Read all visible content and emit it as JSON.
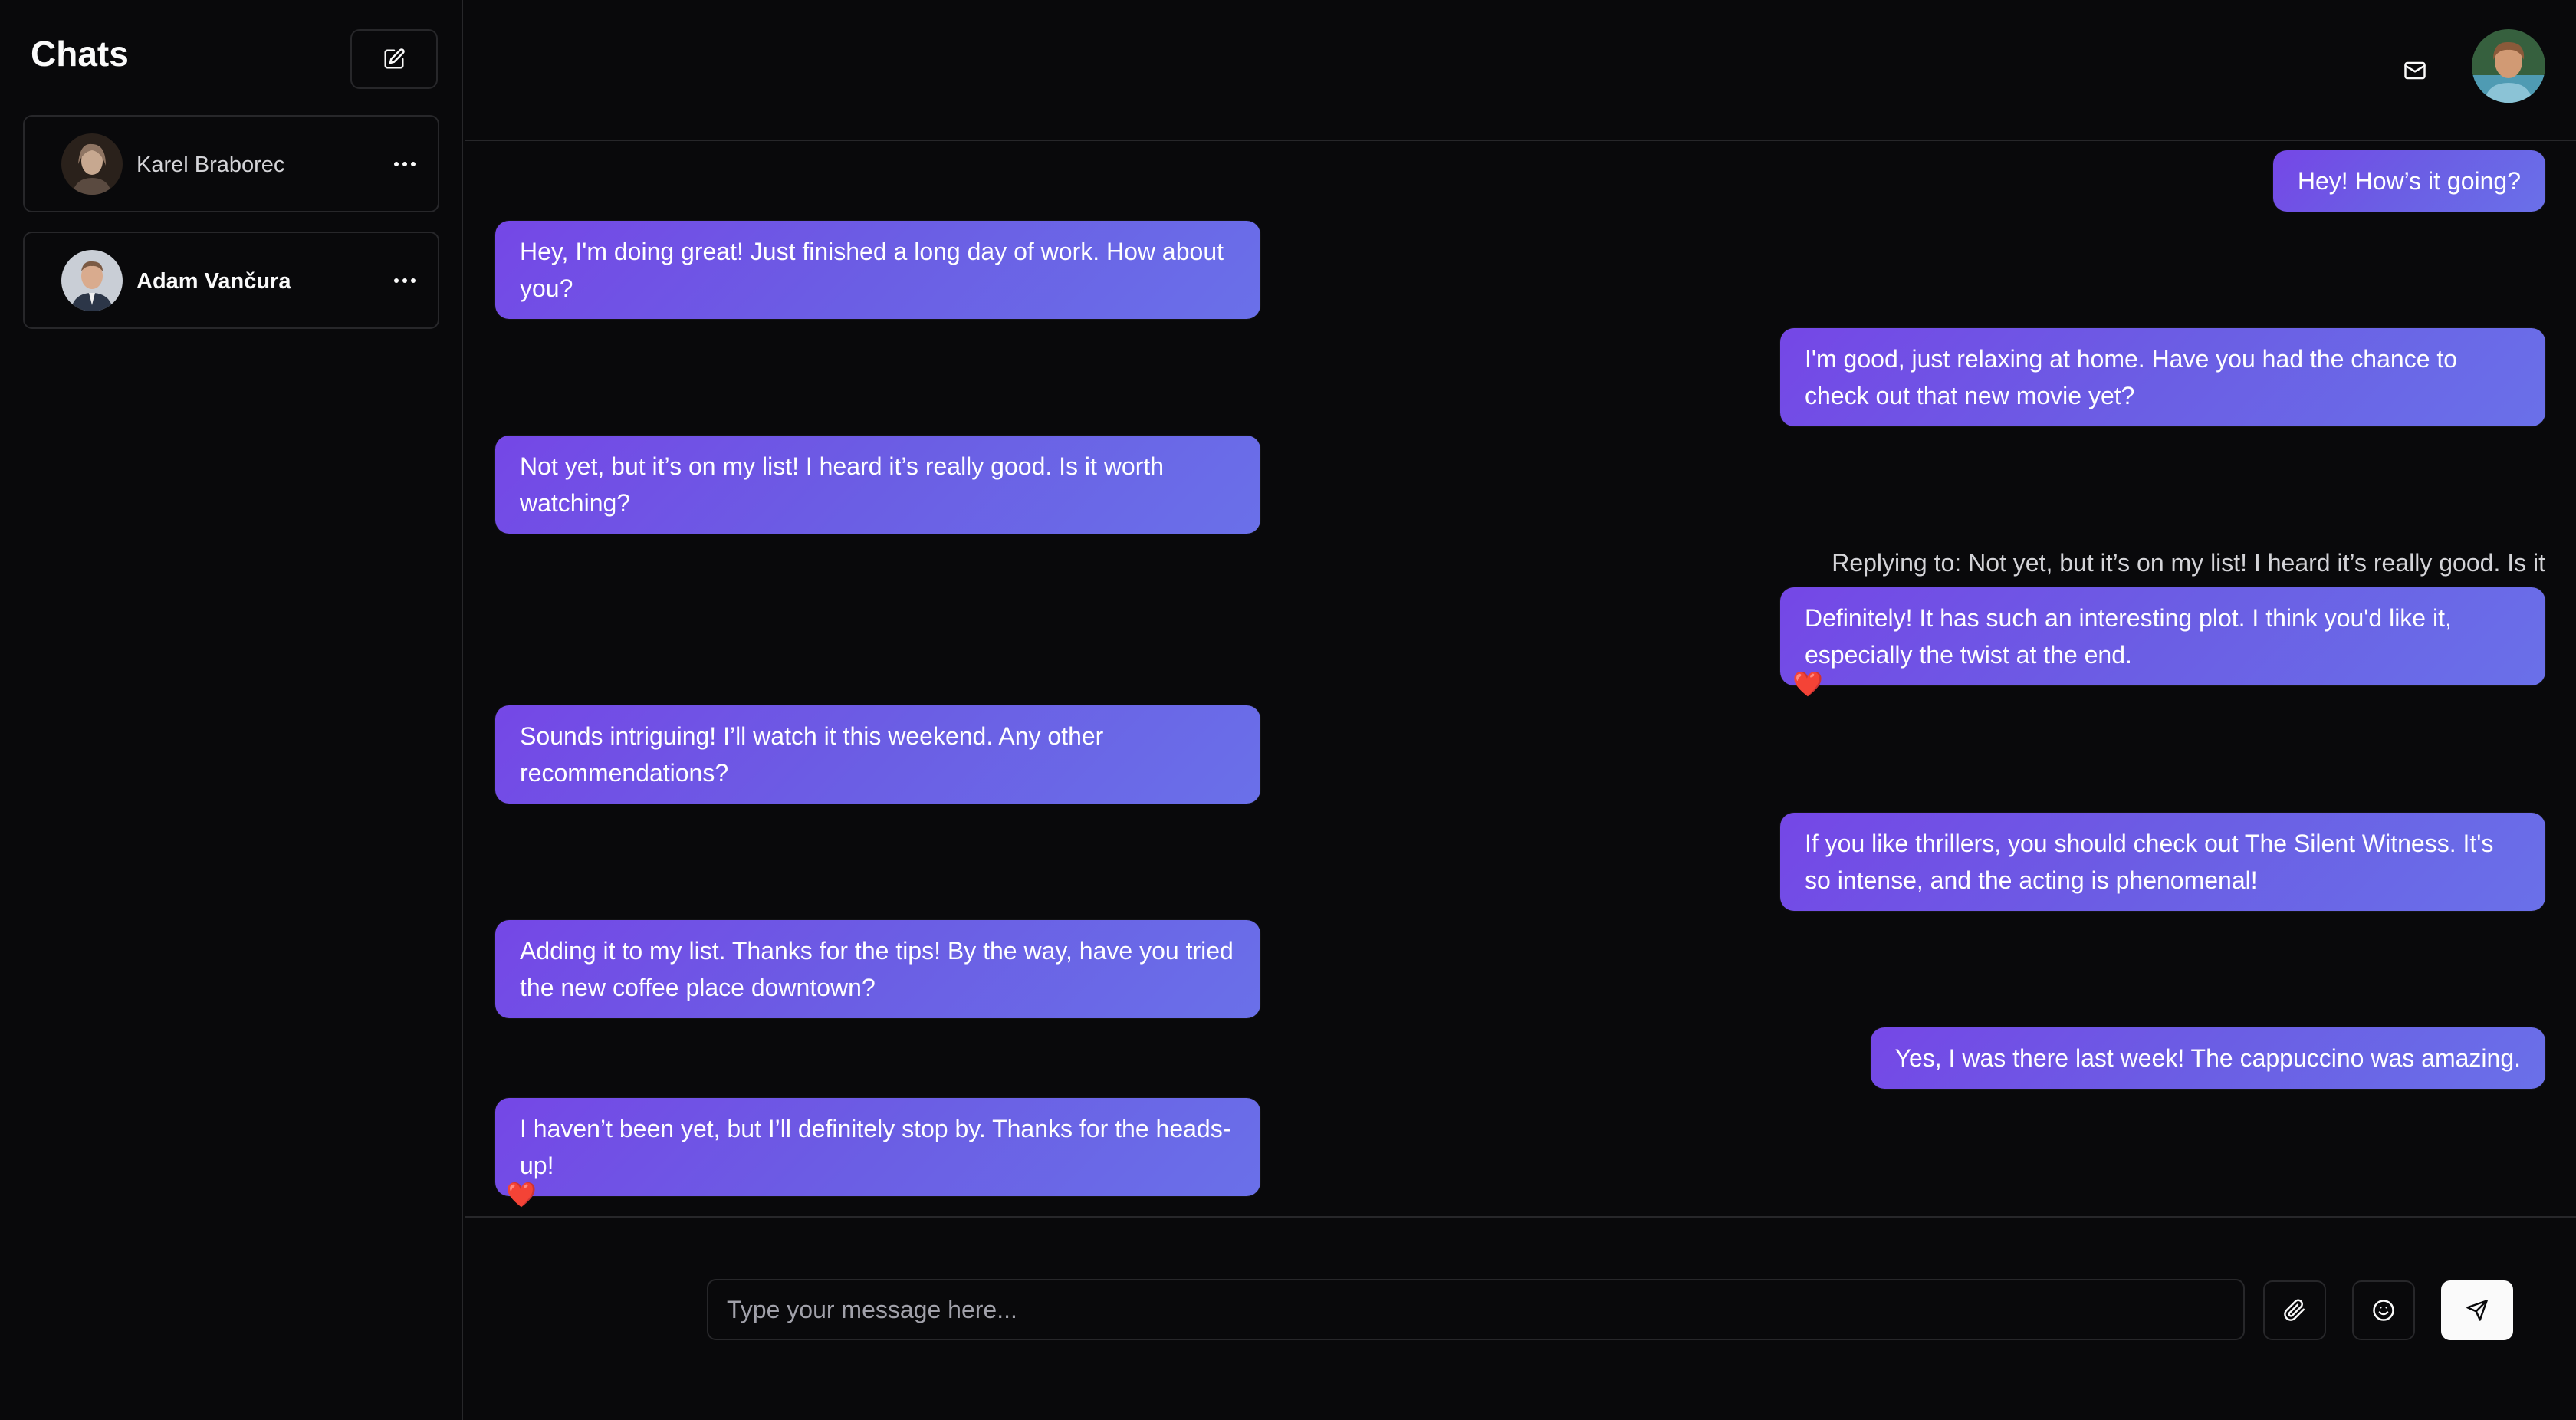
{
  "sidebar": {
    "title": "Chats",
    "new_chat_icon": "edit-icon",
    "chats": [
      {
        "name": "Karel Braborec",
        "avatar_colors": [
          "#3b2e25",
          "#b89a84"
        ]
      },
      {
        "name": "Adam Vančura",
        "avatar_colors": [
          "#c8ccd4",
          "#2c3648"
        ]
      }
    ]
  },
  "header": {
    "mail_icon": "mail-icon",
    "avatar_colors": [
      "#2f5a3a",
      "#c9926a"
    ]
  },
  "messages": [
    {
      "dir": "out",
      "text": "Hey! How’s it going?"
    },
    {
      "dir": "in",
      "text": "Hey, I'm doing great! Just finished a long day of work. How about you?"
    },
    {
      "dir": "out",
      "text": "I'm good, just relaxing at home. Have you had the chance to check out that new movie yet?"
    },
    {
      "dir": "in",
      "text": "Not yet, but it’s on my list! I heard it’s really good. Is it worth watching?"
    },
    {
      "dir": "out",
      "reply_to": "Replying to: Not yet, but it’s on my list! I heard it’s really good. Is it",
      "text": "Definitely! It has such an interesting plot. I think you'd like it, especially the twist at the end.",
      "reaction": "❤️"
    },
    {
      "dir": "in",
      "text": "Sounds intriguing! I’ll watch it this weekend. Any other recommendations?"
    },
    {
      "dir": "out",
      "text": "If you like thrillers, you should check out The Silent Witness. It's so intense, and the acting is phenomenal!"
    },
    {
      "dir": "in",
      "text": "Adding it to my list. Thanks for the tips! By the way, have you tried the new coffee place downtown?"
    },
    {
      "dir": "out",
      "text": "Yes, I was there last week! The cappuccino was amazing."
    },
    {
      "dir": "in",
      "text": "I haven’t been yet, but I’ll definitely stop by. Thanks for the heads-up!",
      "reaction": "❤️"
    }
  ],
  "composer": {
    "placeholder": "Type your message here...",
    "value": "",
    "attach_icon": "paperclip-icon",
    "emoji_icon": "smile-icon",
    "send_icon": "send-icon"
  },
  "colors": {
    "background": "#09090b",
    "border": "#27272a",
    "bubble_start": "#7547e6",
    "bubble_end": "#6a70e9"
  }
}
